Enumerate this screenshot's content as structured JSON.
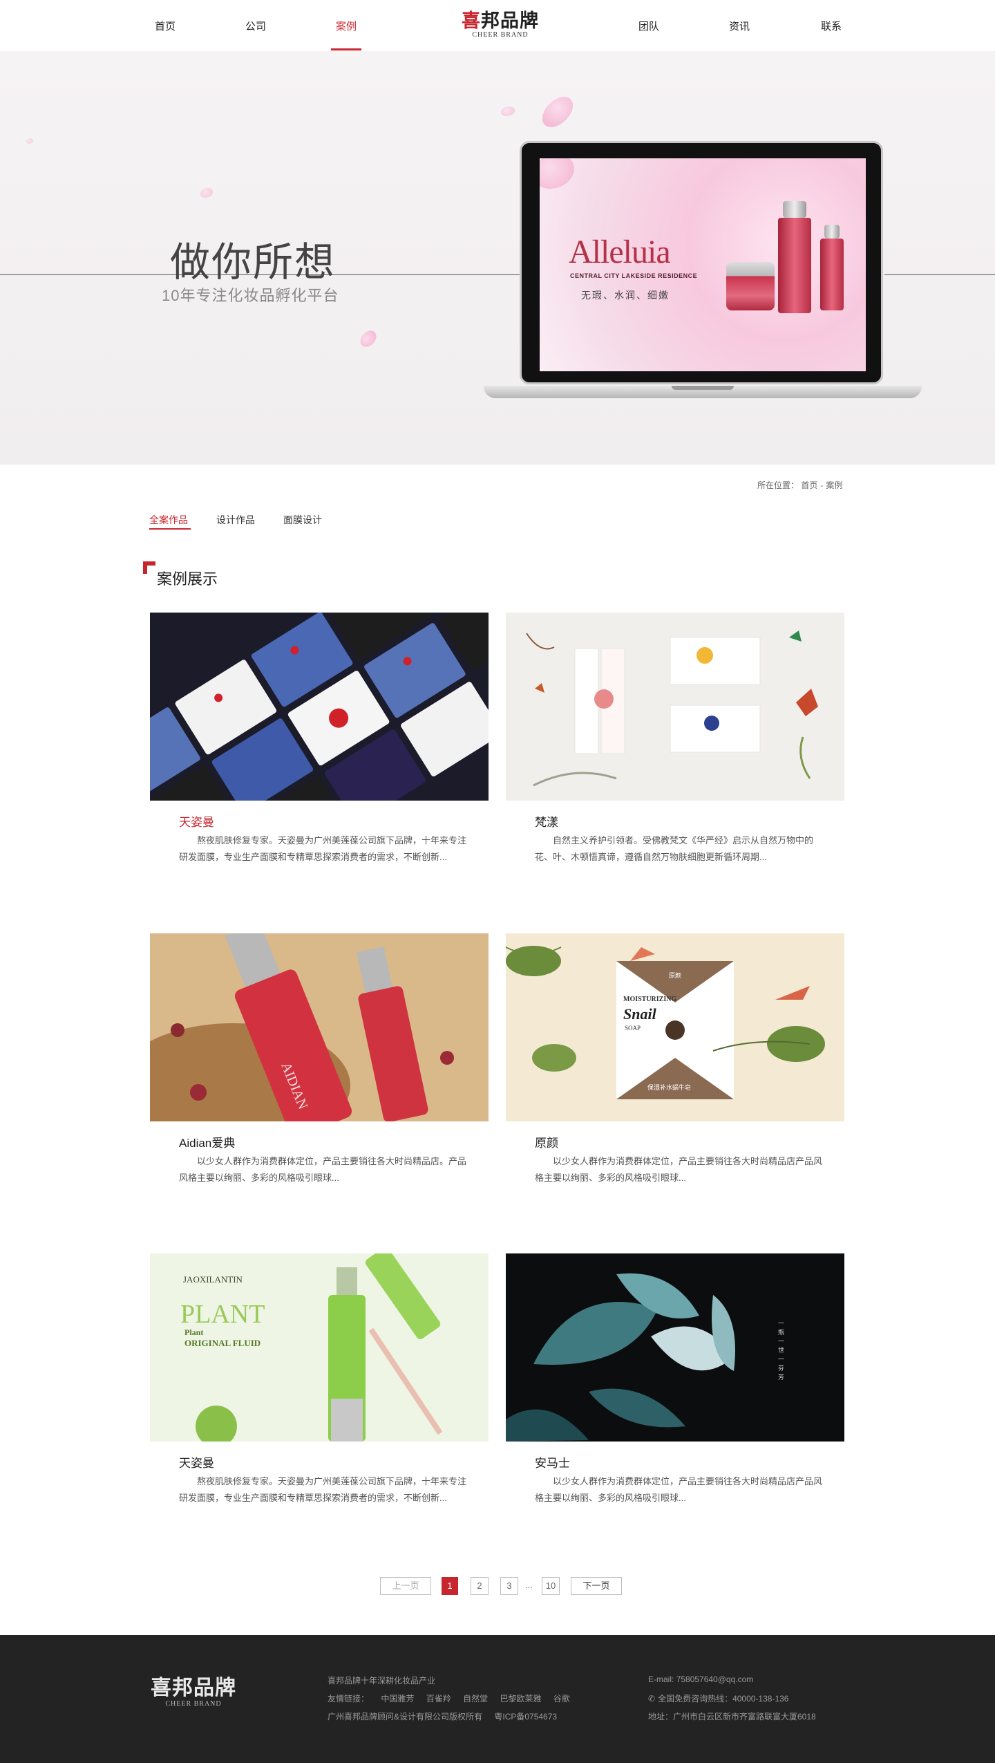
{
  "nav": {
    "items": [
      {
        "label": "首页"
      },
      {
        "label": "公司"
      },
      {
        "label": "案例"
      },
      {
        "label": "团队"
      },
      {
        "label": "资讯"
      },
      {
        "label": "联系"
      }
    ],
    "active_index": 2,
    "logo_cn": "喜邦品牌",
    "logo_en": "CHEER BRAND"
  },
  "hero": {
    "title": "做你所想",
    "subtitle": "10年专注化妆品孵化平台",
    "screen_brand": "Alleluia",
    "screen_sub": "CENTRAL CITY LAKESIDE RESIDENCE",
    "screen_tagline": "无瑕、水润、细嫩"
  },
  "breadcrumb": {
    "prefix": "所在位置：",
    "home": "首页",
    "separator": "-",
    "current": "案例"
  },
  "tabs": [
    {
      "label": "全案作品"
    },
    {
      "label": "设计作品"
    },
    {
      "label": "面膜设计"
    }
  ],
  "section_title": "案例展示",
  "cards": [
    {
      "title": "天姿曼",
      "desc": "熬夜肌肤修复专家。天姿曼为广州美莲葆公司旗下品牌，十年来专注研发面膜，专业生产面膜和专精覃思探索消费者的需求，不断创新..."
    },
    {
      "title": "梵漾",
      "desc": "自然主义养护引领者。受佛教梵文《华严经》启示从自然万物中的花、叶、木顿悟真谛，遵循自然万物肤细胞更新循环周期..."
    },
    {
      "title": "Aidian爱典",
      "desc": "以少女人群作为消费群体定位，产品主要销往各大时尚精品店。产品风格主要以绚丽、多彩的风格吸引眼球..."
    },
    {
      "title": "原颜",
      "desc": "以少女人群作为消费群体定位，产品主要销往各大时尚精品店产品风格主要以绚丽、多彩的风格吸引眼球..."
    },
    {
      "title": "天姿曼",
      "desc": "熬夜肌肤修复专家。天姿曼为广州美莲葆公司旗下品牌，十年来专注研发面膜，专业生产面膜和专精覃思探索消费者的需求，不断创新..."
    },
    {
      "title": "安马士",
      "desc": "以少女人群作为消费群体定位，产品主要销往各大时尚精品店产品风格主要以绚丽、多彩的风格吸引眼球..."
    }
  ],
  "card_images": {
    "img3_text": "AIDIAN",
    "img4_line1": "MOISTURIZING",
    "img4_line2": "Snail",
    "img4_line3": "SOAP",
    "img4_badge": "原颜",
    "img4_cn": "保湿补水蜗牛皂",
    "img5_brand": "JAOXILANTIN",
    "img5_title": "PLANT",
    "img5_line1": "Plant",
    "img5_line2": "ORIGINAL FLUID",
    "img6_vertical": "一瓶一世一芬芳"
  },
  "pagination": {
    "prev": "上一页",
    "pages": [
      "1",
      "2",
      "3"
    ],
    "dots": "...",
    "last": "10",
    "next": "下一页"
  },
  "footer": {
    "logo_cn": "喜邦品牌",
    "logo_en": "CHEER BRAND",
    "slogan": "喜邦品牌十年深耕化妆品产业",
    "links_label": "友情链接：",
    "links": [
      "中国雅芳",
      "百雀羚",
      "自然堂",
      "巴黎欧莱雅",
      "谷歌"
    ],
    "copyright": "广州喜邦品牌顾问&设计有限公司版权所有",
    "icp": "粤ICP备0754673",
    "email": "E-mail: 758057640@qq.com",
    "hotline": "全国免费咨询热线：40000-138-136",
    "address": "地址：广州市白云区新市齐富路联富大厦6018"
  },
  "colors": {
    "accent": "#c8262e",
    "footer_bg": "#232323",
    "hero_bg": "#f4f1f2"
  }
}
